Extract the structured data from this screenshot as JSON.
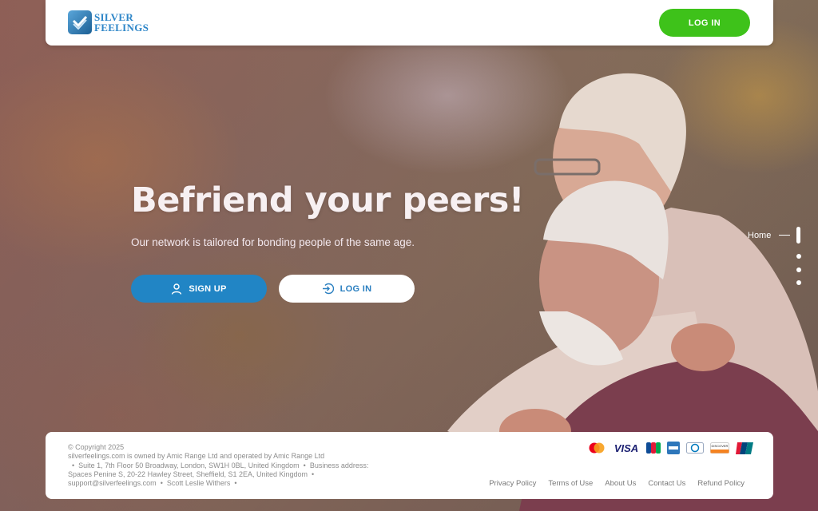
{
  "brand": {
    "name_line1": "SILVER",
    "name_line2": "FEELINGS",
    "accent": "#2e86c8"
  },
  "header": {
    "login_label": "LOG IN",
    "login_color": "#3ec21a"
  },
  "hero": {
    "title": "Befriend your peers!",
    "subtitle": "Our network is tailored for bonding people of the same age.",
    "signup_label": "SIGN UP",
    "login_label": "LOG IN",
    "signup_icon": "user-icon",
    "login_icon": "login-arrow-icon"
  },
  "side_nav": {
    "active_label": "Home",
    "items": 4
  },
  "footer": {
    "copyright": "© Copyright 2025",
    "owner_line": "silverfeelings.com is owned by Amic Range Ltd and operated by Amic Range Ltd",
    "address": "Suite 1, 7th Floor 50 Broadway, London, SW1H 0BL, United Kingdom",
    "business_label": "Business address:",
    "business_address": "Spaces Penine S, 20-22 Hawley Street, Sheffield, S1 2EA, United Kingdom",
    "email": "support@silverfeelings.com",
    "person": "Scott Leslie Withers",
    "payment_icons": [
      "mastercard-icon",
      "visa-icon",
      "jcb-icon",
      "amex-icon",
      "diners-icon",
      "discover-icon",
      "unionpay-icon"
    ],
    "visa_text": "VISA",
    "discover_text": "DISCOVER",
    "links": [
      "Privacy Policy",
      "Terms of Use",
      "About Us",
      "Contact Us",
      "Refund Policy"
    ]
  }
}
